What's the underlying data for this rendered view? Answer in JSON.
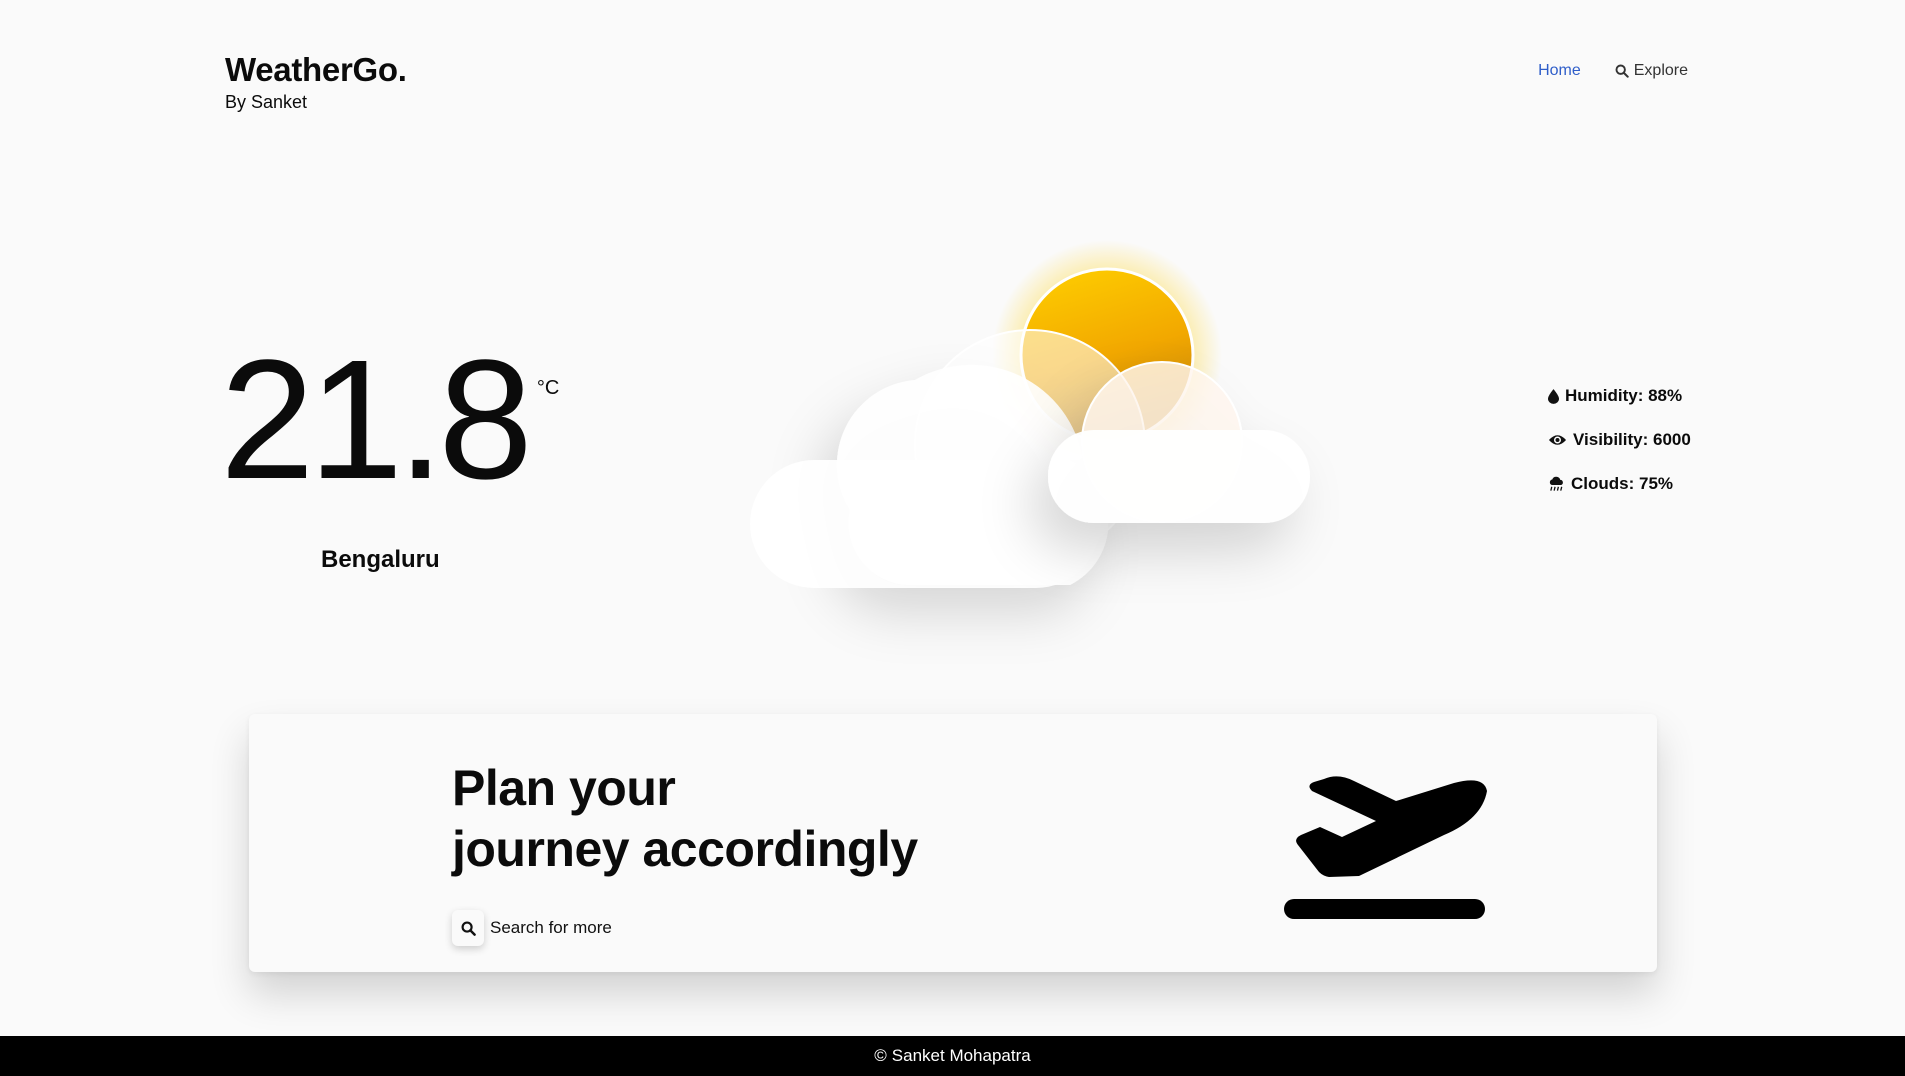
{
  "brand": {
    "title": "WeatherGo.",
    "subtitle": "By Sanket"
  },
  "nav": {
    "home_label": "Home",
    "explore_label": "Explore",
    "explore_icon": "search-icon",
    "active": "Home"
  },
  "weather": {
    "temperature": "21.8",
    "unit": "°C",
    "city": "Bengaluru",
    "condition_icon": "sun-behind-cloud-icon"
  },
  "stats": [
    {
      "icon": "droplet-icon",
      "text": "Humidity: 88%"
    },
    {
      "icon": "eye-icon",
      "text": "Visibility: 6000"
    },
    {
      "icon": "cloud-rain-icon",
      "text": "Clouds: 75%"
    }
  ],
  "plan": {
    "title_line1": "Plan your",
    "title_line2": "journey accordingly",
    "search_label": "Search for more",
    "illustration_icon": "plane-departure-icon"
  },
  "footer": {
    "symbol": "©",
    "text": "Sanket Mohapatra"
  },
  "colors": {
    "accent": "#2f5ec9",
    "sun": "#ffc400",
    "footer_bg": "#000000",
    "background": "#fafafa"
  }
}
